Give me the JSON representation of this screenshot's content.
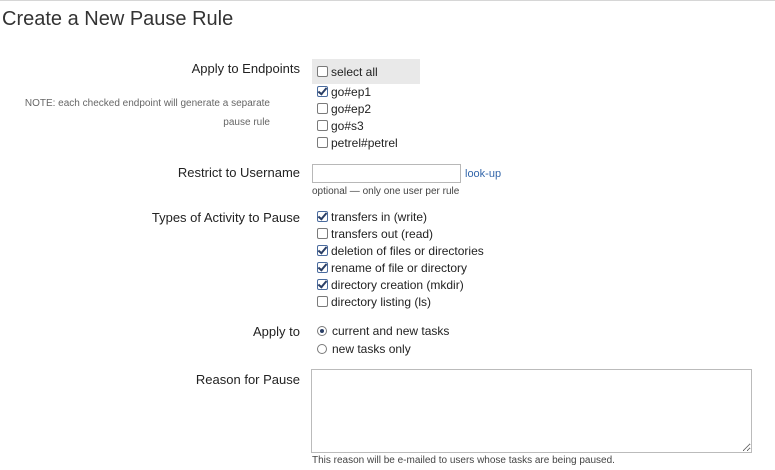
{
  "page": {
    "title": "Create a New Pause Rule"
  },
  "endpoints": {
    "label": "Apply to Endpoints",
    "note": "NOTE: each checked endpoint will generate a separate pause rule",
    "select_all": {
      "label": "select all",
      "checked": false
    },
    "items": [
      {
        "label": "go#ep1",
        "checked": true
      },
      {
        "label": "go#ep2",
        "checked": false
      },
      {
        "label": "go#s3",
        "checked": false
      },
      {
        "label": "petrel#petrel",
        "checked": false
      }
    ]
  },
  "username": {
    "label": "Restrict to Username",
    "value": "",
    "lookup_link": "look-up",
    "hint": "optional — only one user per rule"
  },
  "activity": {
    "label": "Types of Activity to Pause",
    "items": [
      {
        "label": "transfers in (write)",
        "checked": true
      },
      {
        "label": "transfers out (read)",
        "checked": false
      },
      {
        "label": "deletion of files or directories",
        "checked": true
      },
      {
        "label": "rename of file or directory",
        "checked": true
      },
      {
        "label": "directory creation (mkdir)",
        "checked": true
      },
      {
        "label": "directory listing (ls)",
        "checked": false
      }
    ]
  },
  "apply_to": {
    "label": "Apply to",
    "options": [
      {
        "label": "current and new tasks",
        "selected": true
      },
      {
        "label": "new tasks only",
        "selected": false
      }
    ]
  },
  "reason": {
    "label": "Reason for Pause",
    "value": "",
    "hint": "This reason will be e-mailed to users whose tasks are being paused."
  }
}
